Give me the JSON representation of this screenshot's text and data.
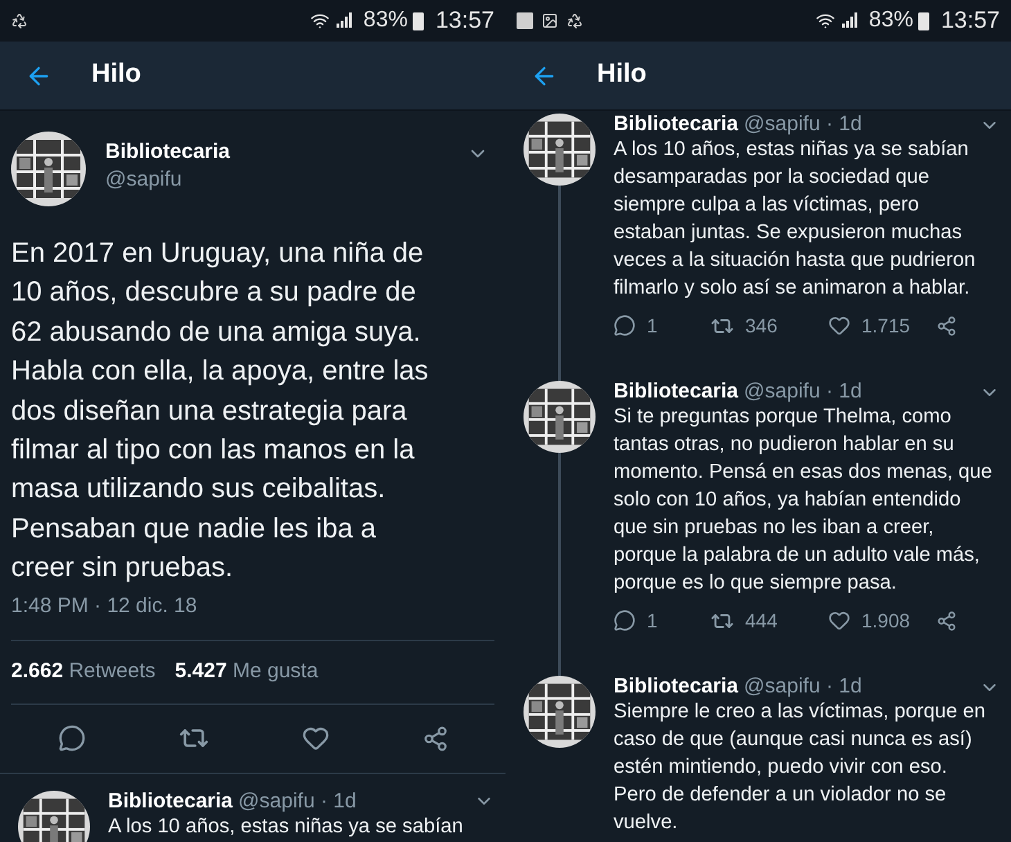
{
  "panels": [
    {
      "status_bar": {
        "battery": "83%",
        "time": "13:57"
      },
      "header": {
        "title": "Hilo"
      },
      "main_tweet": {
        "name": "Bibliotecaria",
        "handle": "@sapifu",
        "text": "En 2017 en Uruguay, una niña de\n10 años, descubre a su padre de\n62 abusando de una amiga suya.\nHabla con ella, la apoya, entre las\ndos diseñan una estrategia para\nfilmar al tipo con las manos en la\nmasa utilizando sus ceibalitas.\nPensaban que nadie les iba a\ncreer sin pruebas.",
        "timestamp": "1:48 PM · 12 dic. 18",
        "retweets_count": "2.662",
        "retweets_label": "Retweets",
        "likes_count": "5.427",
        "likes_label": "Me gusta"
      },
      "tweets": [
        {
          "name": "Bibliotecaria",
          "meta": "@sapifu · 1d",
          "text": "A los 10 años, estas niñas ya se sabían"
        }
      ]
    },
    {
      "status_bar": {
        "battery": "83%",
        "time": "13:57"
      },
      "header": {
        "title": "Hilo"
      },
      "tweets": [
        {
          "name": "Bibliotecaria",
          "meta": "@sapifu · 1d",
          "text": "A los 10 años, estas niñas ya se sabían\ndesamparadas por la sociedad que\nsiempre culpa a las víctimas, pero\nestaban juntas. Se expusieron muchas\nveces a la situación hasta que pudrieron\nfilmarlo y solo así se animaron a hablar.",
          "replies": "1",
          "retweets": "346",
          "likes": "1.715"
        },
        {
          "name": "Bibliotecaria",
          "meta": "@sapifu · 1d",
          "text": "Si te preguntas porque Thelma, como\ntantas otras, no pudieron hablar en su\nmomento. Pensá en esas dos menas, que\nsolo con 10 años, ya habían entendido\nque sin pruebas no les iban a creer,\nporque la palabra de un adulto vale más,\nporque es lo que siempre pasa.",
          "replies": "1",
          "retweets": "444",
          "likes": "1.908"
        },
        {
          "name": "Bibliotecaria",
          "meta": "@sapifu · 1d",
          "text": "Siempre le creo a las víctimas, porque en\ncaso de que (aunque casi nunca es así)\nestén mintiendo, puedo vivir con eso.\nPero de defender a un violador no se\nvuelve."
        }
      ]
    }
  ]
}
